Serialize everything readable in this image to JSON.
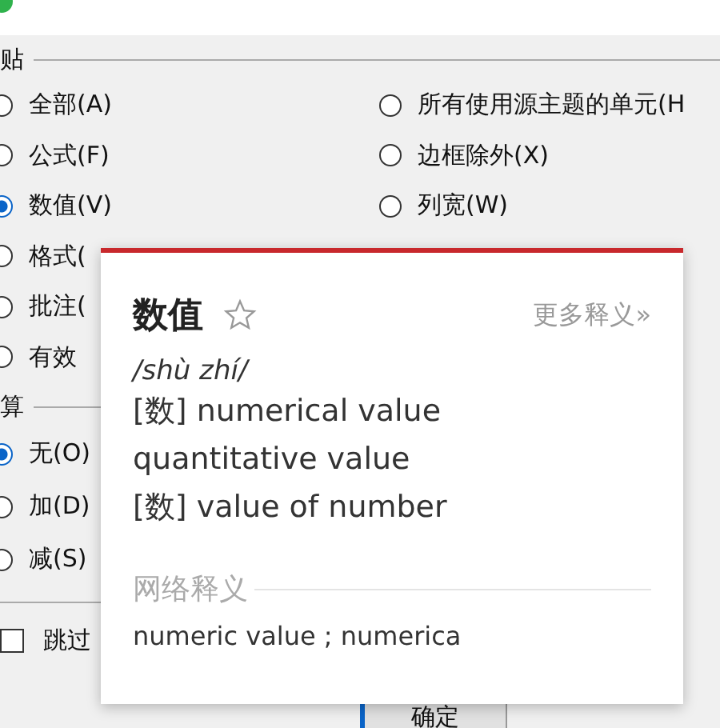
{
  "paste_section": {
    "label": "贴",
    "left_options": [
      {
        "label": "全部(A)",
        "selected": false
      },
      {
        "label": "公式(F)",
        "selected": false
      },
      {
        "label": "数值(V)",
        "selected": true
      },
      {
        "label": "格式(",
        "selected": false
      },
      {
        "label": "批注(",
        "selected": false
      },
      {
        "label": "有效",
        "selected": false
      }
    ],
    "right_options": [
      {
        "label": "所有使用源主题的单元(H",
        "selected": false
      },
      {
        "label": "边框除外(X)",
        "selected": false
      },
      {
        "label": "列宽(W)",
        "selected": false
      }
    ]
  },
  "operation_section": {
    "label": "算",
    "options": [
      {
        "label": "无(O)",
        "selected": true
      },
      {
        "label": "加(D)",
        "selected": false
      },
      {
        "label": "减(S)",
        "selected": false
      }
    ]
  },
  "skip_blanks": {
    "label": "跳过",
    "checked": false
  },
  "ok_button": "确定",
  "dictionary_popup": {
    "word": "数值",
    "more_link": "更多释义»",
    "pinyin": "/shù zhí/",
    "definitions": [
      "[数] numerical value",
      "quantitative value",
      "[数] value of number"
    ],
    "web_heading": "网络释义",
    "web_definition": "numeric value ; numerica"
  }
}
